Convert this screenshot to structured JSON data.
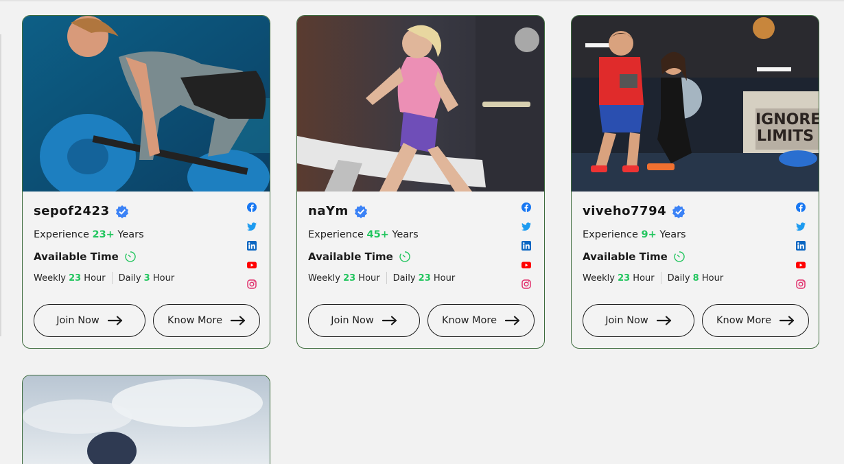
{
  "colors": {
    "accent_green": "#22c55e",
    "card_border": "#3d6b3d",
    "verified_blue": "#3b82f6",
    "facebook": "#1877f2",
    "twitter": "#1d9bf0",
    "linkedin": "#0a66c2",
    "youtube": "#ff0000",
    "instagram": "#e1306c"
  },
  "labels": {
    "experience": "Experience",
    "years": "Years",
    "available_time": "Available Time",
    "weekly": "Weekly",
    "daily": "Daily",
    "hour": "Hour",
    "join_now": "Join Now",
    "know_more": "Know More"
  },
  "icons": [
    "verified-badge-icon",
    "timer-icon",
    "facebook-icon",
    "twitter-icon",
    "linkedin-icon",
    "youtube-icon",
    "instagram-icon",
    "arrow-right-icon"
  ],
  "trainers": [
    {
      "name": "sepof2423",
      "experience": "23+",
      "weekly_hours": "23",
      "daily_hours": "3",
      "photo": "woman lifting barbell"
    },
    {
      "name": "naYm",
      "experience": "45+",
      "weekly_hours": "23",
      "daily_hours": "23",
      "photo": "woman running on treadmill"
    },
    {
      "name": "viveho7794",
      "experience": "9+",
      "weekly_hours": "23",
      "daily_hours": "8",
      "photo": "trainer with client in gym"
    }
  ]
}
